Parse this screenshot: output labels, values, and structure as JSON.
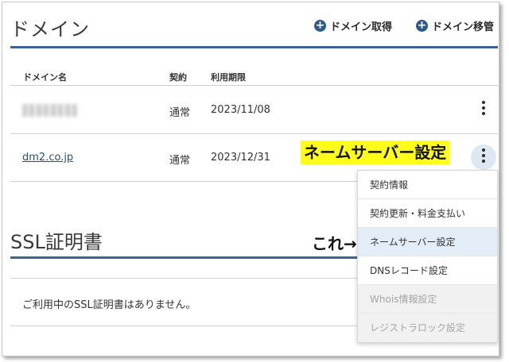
{
  "domains": {
    "title": "ドメイン",
    "actions": [
      {
        "icon": "plus-circle-icon",
        "label": "ドメイン取得"
      },
      {
        "icon": "plus-circle-icon",
        "label": "ドメイン移管"
      }
    ],
    "columns": [
      "ドメイン名",
      "契約",
      "利用期限"
    ],
    "rows": [
      {
        "name": "",
        "contract": "通常",
        "expiry": "2023/11/08"
      },
      {
        "name": "dm2.co.jp",
        "contract": "通常",
        "expiry": "2023/12/31"
      }
    ]
  },
  "annotation": {
    "highlight_label": "ネームサーバー設定",
    "pointer_text": "これ→"
  },
  "menu": {
    "items": [
      {
        "label": "契約情報",
        "state": "normal"
      },
      {
        "label": "契約更新・料金支払い",
        "state": "normal"
      },
      {
        "label": "ネームサーバー設定",
        "state": "hover"
      },
      {
        "label": "DNSレコード設定",
        "state": "normal"
      },
      {
        "label": "Whois情報設定",
        "state": "disabled"
      },
      {
        "label": "レジストラロック設定",
        "state": "disabled"
      }
    ]
  },
  "ssl": {
    "title": "SSL証明書",
    "empty_message": "ご利用中のSSL証明書はありません。"
  },
  "colors": {
    "accent_blue": "#3a6391",
    "highlight_yellow": "#ffff1a",
    "menu_hover": "#e3edf7"
  }
}
